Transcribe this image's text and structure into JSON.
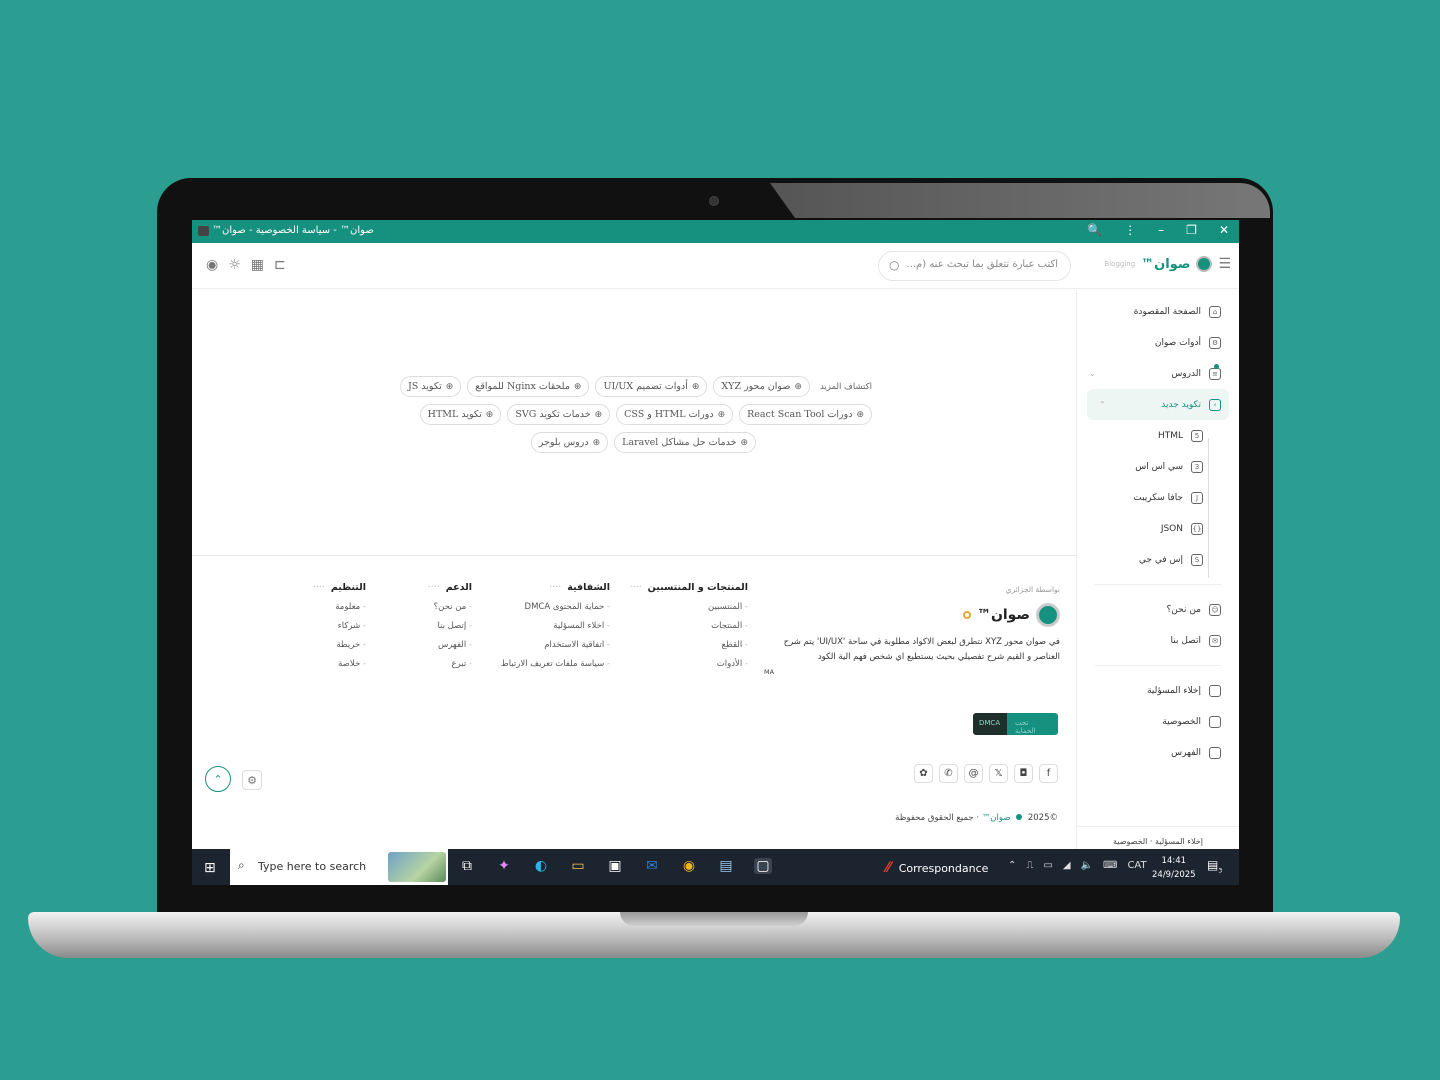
{
  "window": {
    "title": "صوان™ - سياسة الخصوصية - صوان™",
    "controls": [
      "🔍",
      "⋮",
      "–",
      "❐",
      "✕"
    ]
  },
  "topbar": {
    "search_placeholder": "اكتب عبارة تتعلق بما تبحث عنه (م...",
    "brand_name": "صوان™",
    "brand_tag": "Blogging"
  },
  "sidebar": {
    "items": [
      {
        "label": "الصفحة المقصودة",
        "icon": "home-icon"
      },
      {
        "label": "أدوات صوان",
        "icon": "tools-icon"
      },
      {
        "label": "الدروس",
        "icon": "lessons-icon"
      },
      {
        "label": "تكويد جديد",
        "icon": "code-icon"
      }
    ],
    "sub_items": [
      {
        "label": "HTML",
        "icon": "html-file-icon"
      },
      {
        "label": "سي اس اس",
        "icon": "css-file-icon"
      },
      {
        "label": "جافا سكريبت",
        "icon": "js-file-icon"
      },
      {
        "label": "JSON",
        "icon": "json-file-icon"
      },
      {
        "label": "إس في جي",
        "icon": "svg-file-icon"
      }
    ],
    "contact": [
      {
        "label": "من نحن؟",
        "icon": "user-icon"
      },
      {
        "label": "اتصل بنا",
        "icon": "mail-icon"
      }
    ],
    "pages": [
      {
        "label": "إخلاء المسؤلية",
        "icon": "page-icon"
      },
      {
        "label": "الخصوصية",
        "icon": "page-icon"
      },
      {
        "label": "الفهرس",
        "icon": "page-icon"
      }
    ],
    "footer_links": "إخلاء المسؤلية · الخصوصية"
  },
  "explore": {
    "label": "اكتشاف المزيد",
    "rows": [
      [
        "صوان محور XYZ",
        "أدوات تصميم UI/UX",
        "ملحقات Nginx للمواقع",
        "تكويد JS"
      ],
      [
        "دورات React Scan Tool",
        "دورات HTML و CSS",
        "خدمات تكويد SVG",
        "تكويد HTML"
      ],
      [
        "خدمات حل مشاكل Laravel",
        "دروس بلوجر"
      ]
    ]
  },
  "footer": {
    "by_label": "بواسطة الجزائري",
    "logo_name": "صوان™",
    "description": "في صوان محور XYZ نتطرق لبعض الاكواد مطلوبة في ساحة 'UI/UX' يتم شرح العناصر و القيم شرح تفصيلي بحيث يستطيع اي شخص فهم الية الكود",
    "ma": "MA",
    "badge_top": "تحت الحماية",
    "badge_dmca": "DMCA",
    "columns": [
      {
        "title": "المنتجات و المنتسبين",
        "items": [
          "المنتسبين",
          "المنتجات",
          "القطع",
          "الأدوات"
        ]
      },
      {
        "title": "الشفافية",
        "items": [
          "حماية المحتوى DMCA",
          "اخلاء المسؤلية",
          "اتفاقية الاستخدام",
          "سياسة ملفات تعريف الارتباط"
        ]
      },
      {
        "title": "الدعم",
        "items": [
          "من نحن؟",
          "إتصل بنا",
          "الفهرس",
          "تبرع"
        ]
      },
      {
        "title": "التنظيم",
        "items": [
          "معلومة",
          "شركاء",
          "خريطة",
          "خلاصة"
        ]
      }
    ],
    "copyright_year": "©2025",
    "copyright_brand": "صوان™",
    "copyright_text": "جميع الحقوق محفوظة"
  },
  "taskbar": {
    "search_placeholder": "Type here to search",
    "active_app": "Correspondance",
    "language": "CAT",
    "time": "14:41",
    "date": "24/9/2025",
    "notifications": "3"
  }
}
